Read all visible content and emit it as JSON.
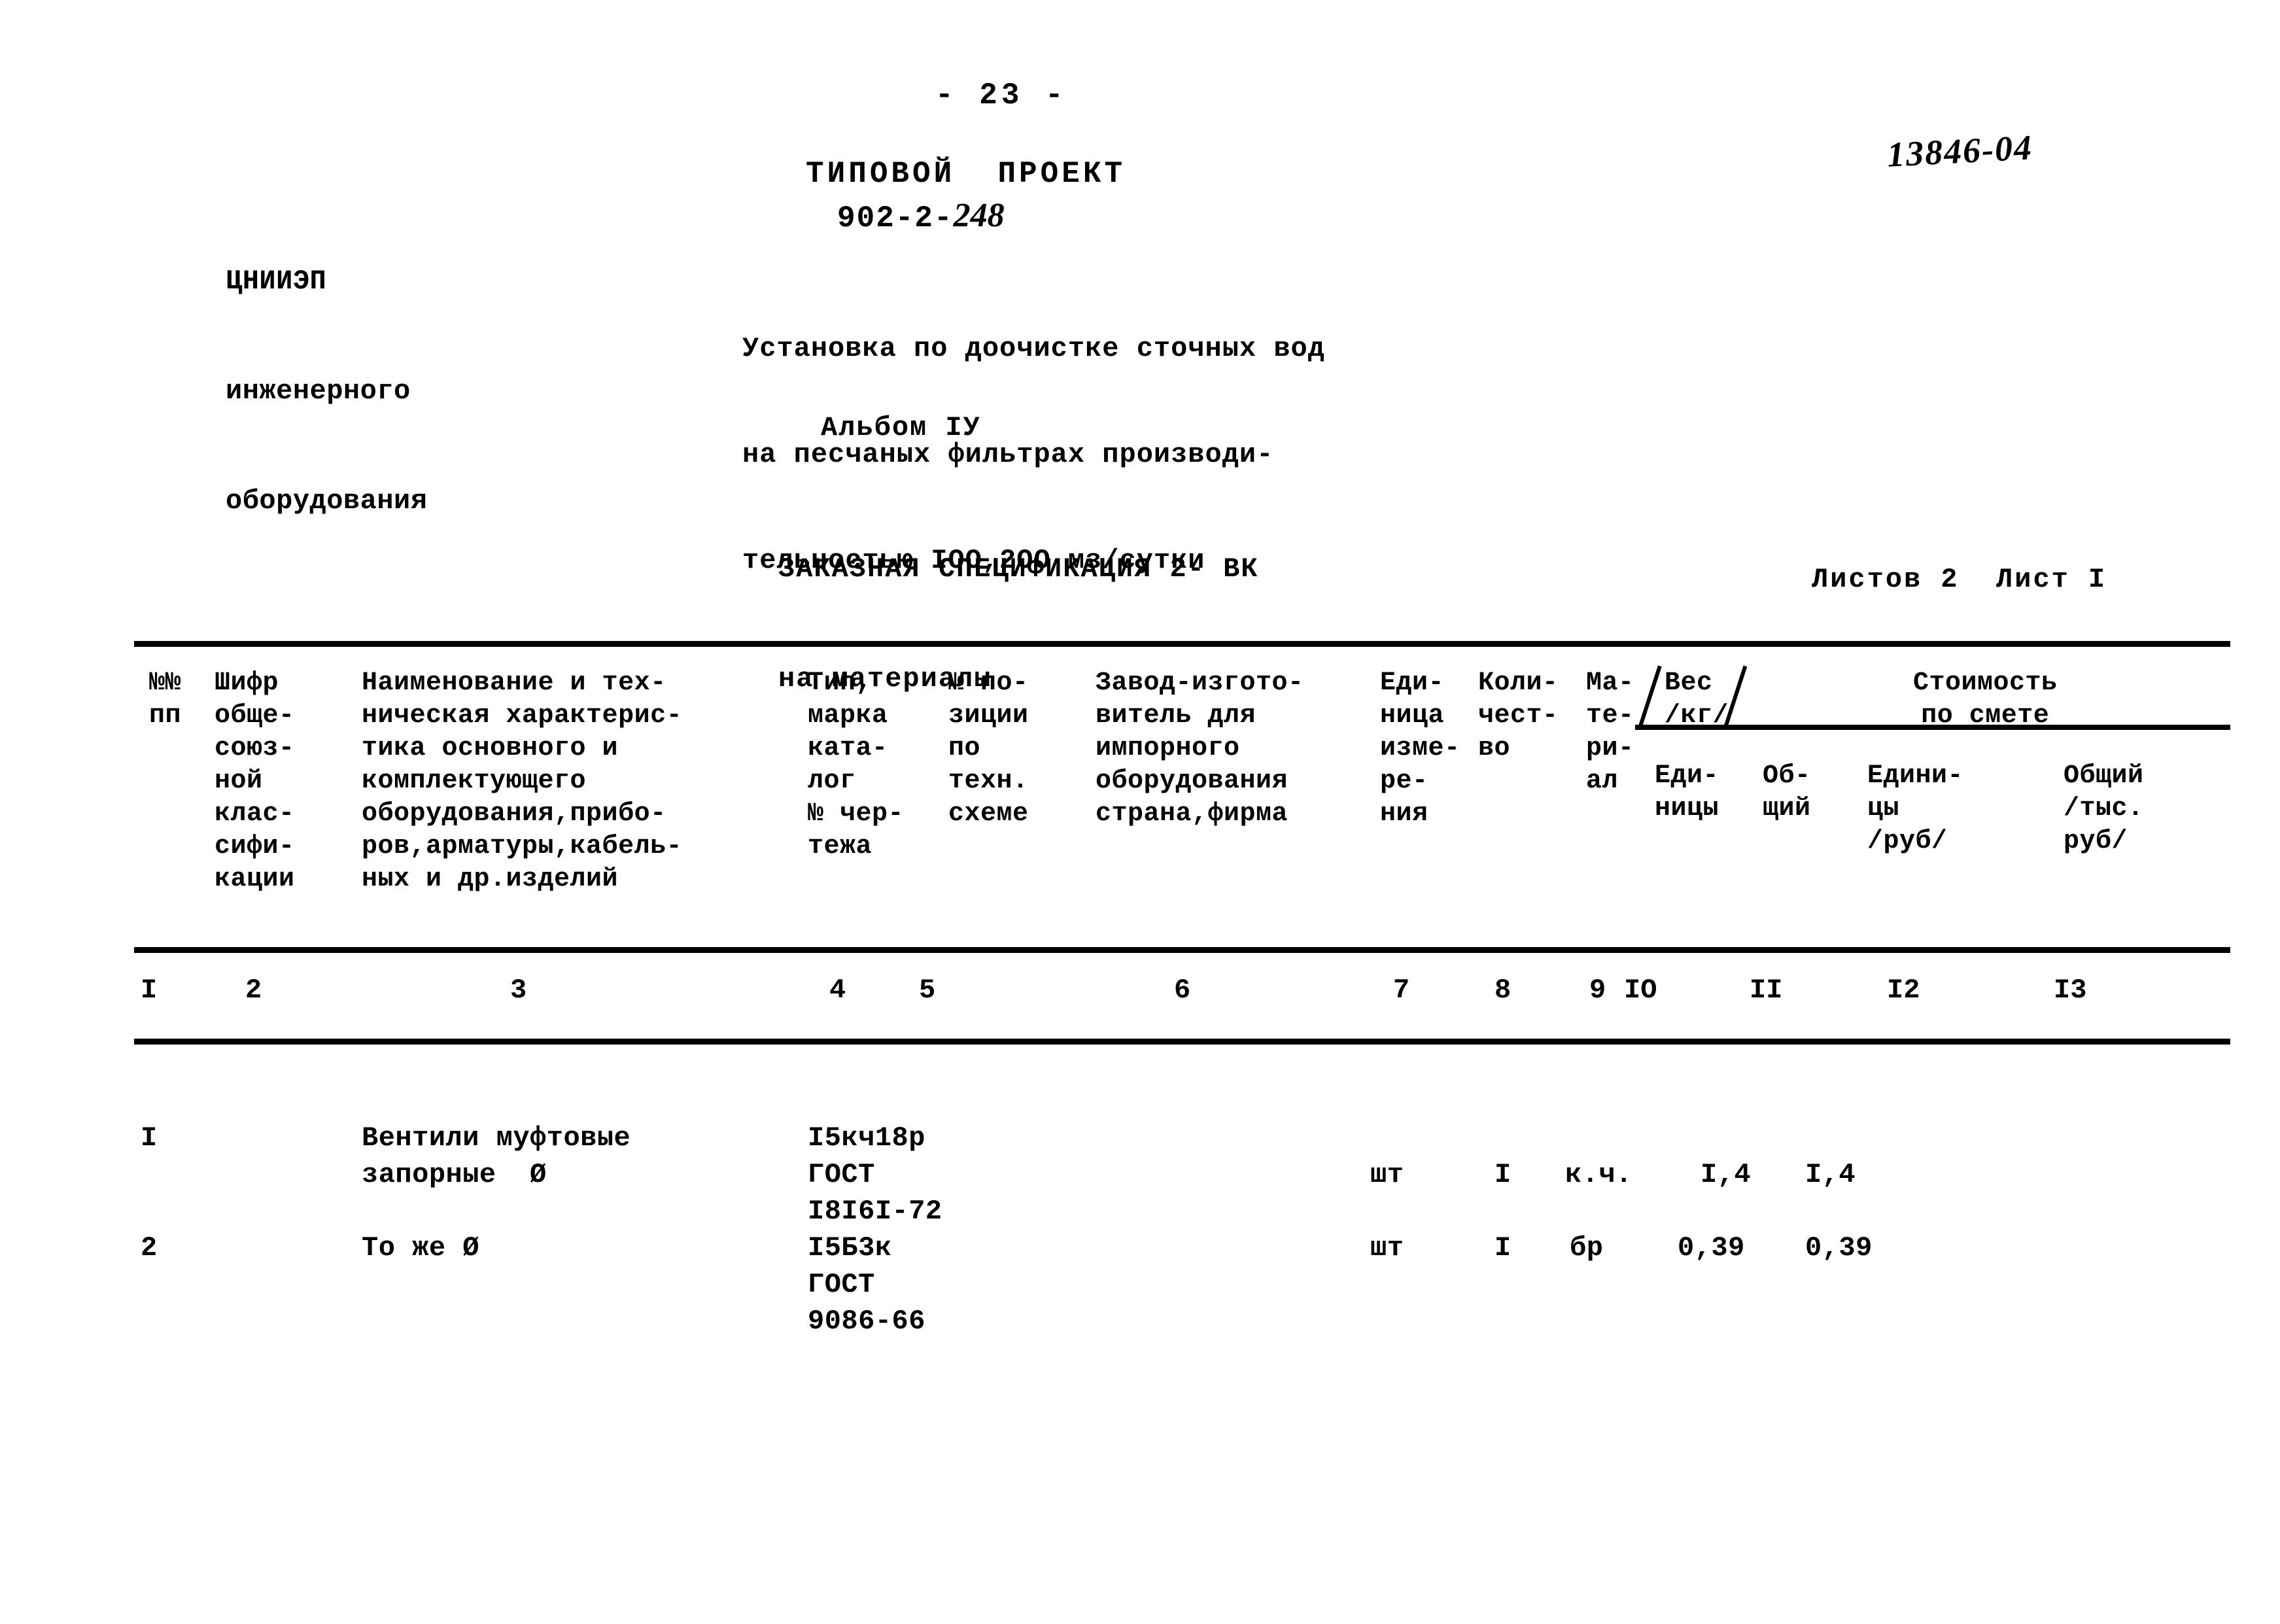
{
  "page": {
    "number": "- 23 -",
    "stamp_code": "13846-04",
    "sheets": "Листов 2  Лист I"
  },
  "organization": {
    "line1": "ЦНИИЭП",
    "line2": "инженерного",
    "line3": "оборудования"
  },
  "project": {
    "label": "ТИПОВОЙ  ПРОЕКТ",
    "code_printed": "902-2-",
    "code_hand": "248",
    "desc_line1": "Установка по доочистке сточных вод",
    "desc_line2": "на песчаных фильтрах производи-",
    "desc_line3": "тельностью IОО,2ОО мз/сутки",
    "album": "Альбом IУ",
    "spec_line1": "ЗАКАЗНАЯ СПЕЦИФИКАЦИЯ 2- ВК",
    "spec_line2": "на материалы"
  },
  "table": {
    "headers": {
      "c1": "№№\nпп",
      "c2": "Шифр\nобще-\nсоюз-\nной\nклас-\nсифи-\nкации",
      "c3": "Наименование и тех-\nническая характерис-\nтика основного и\nкомплектующего\nоборудования,прибо-\nров,арматуры,кабель-\nных и др.изделий",
      "c4": "Тип,\nмарка\nката-\nлог\n№ чер-\nтежа",
      "c5": "№ по-\nзиции\nпо\nтехн.\nсхеме",
      "c6": "Завод-изгото-\nвитель для\nимпорного\nоборудования\nстрана,фирма",
      "c7": "Еди-\nница\nизме-\nре-\nния",
      "c8": "Коли-\nчест-\nво",
      "c9": "Ма-\nте-\nри-\nал",
      "c_weight_group": "Вес\n/кг/",
      "c10": "Еди-\nницы",
      "c11": "Об-\nщий",
      "c_cost_group": "Стоимость\nпо смете",
      "c12": "Едини-\nцы\n/руб/",
      "c13": "Общий\n/тыс.\nруб/"
    },
    "column_numbers": [
      "I",
      "2",
      "3",
      "4",
      "5",
      "6",
      "7",
      "8",
      "9",
      "IО",
      "II",
      "I2",
      "I3"
    ],
    "rows": [
      {
        "no": "I",
        "code": "",
        "name": "Вентили муфтовые\nзапорные  Ø",
        "type": "I5кч18р\nГОСТ\nI8I6I-72",
        "pos": "",
        "maker": "",
        "unit": "шт",
        "qty": "I",
        "material": "к.ч.",
        "weight_unit": "I,4",
        "weight_total": "I,4",
        "cost_unit": "",
        "cost_total": ""
      },
      {
        "no": "2",
        "code": "",
        "name": "То же Ø",
        "type": "I5Б3к\nГОСТ\n9086-66",
        "pos": "",
        "maker": "",
        "unit": "шт",
        "qty": "I",
        "material": "бр",
        "weight_unit": "0,39",
        "weight_total": "0,39",
        "cost_unit": "",
        "cost_total": ""
      }
    ]
  }
}
